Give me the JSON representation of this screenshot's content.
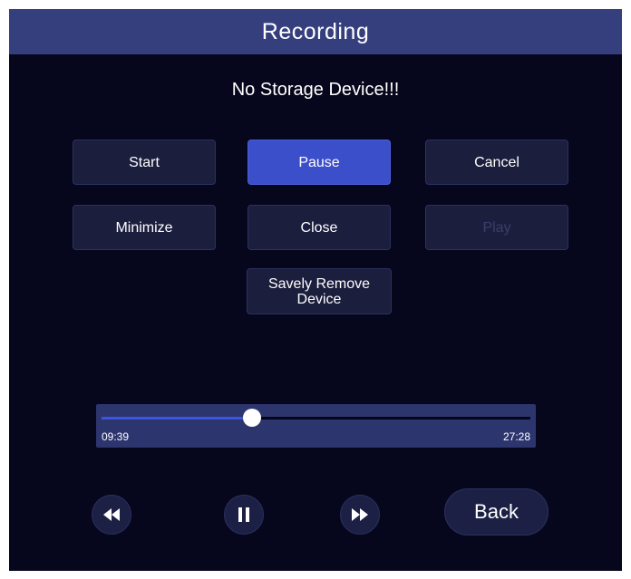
{
  "window": {
    "title": "Recording"
  },
  "status": {
    "message": "No Storage Device!!!"
  },
  "buttons": {
    "start": "Start",
    "pause": "Pause",
    "cancel": "Cancel",
    "minimize": "Minimize",
    "close": "Close",
    "play": "Play",
    "remove_device": "Savely Remove Device"
  },
  "playback": {
    "current_time": "09:39",
    "total_time": "27:28",
    "progress_fraction": 0.351,
    "back_label": "Back",
    "controls": {
      "rewind_icon": "rewind-icon",
      "pause_icon": "pause-icon",
      "fast_forward_icon": "fast-forward-icon"
    }
  },
  "colors": {
    "background": "#06071d",
    "titlebar": "#363f7e",
    "button": "#1b1e3d",
    "active_button": "#3c4fca",
    "progress_panel": "#2d356e",
    "progress_fill": "#3a55e0",
    "disabled_text": "#3a3f6e"
  }
}
